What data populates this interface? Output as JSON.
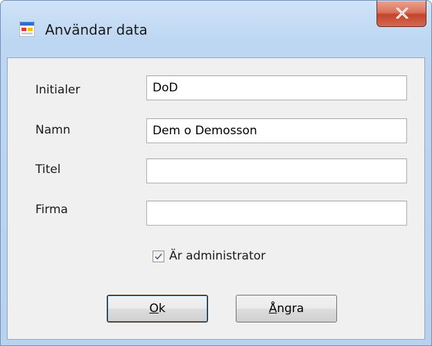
{
  "window": {
    "title": "Användar data",
    "icons": {
      "app": "form-window-icon",
      "close": "close-x-icon"
    }
  },
  "form": {
    "fields": [
      {
        "label": "Initialer",
        "value": "DoD"
      },
      {
        "label": "Namn",
        "value": "Dem o Demosson"
      },
      {
        "label": "Titel",
        "value": ""
      },
      {
        "label": "Firma",
        "value": ""
      }
    ],
    "admin_checkbox": {
      "label": "Är administrator",
      "checked": true
    }
  },
  "buttons": {
    "ok": {
      "mnemonic": "O",
      "rest": "k"
    },
    "cancel": {
      "mnemonic": "Å",
      "rest": "ngra"
    }
  }
}
